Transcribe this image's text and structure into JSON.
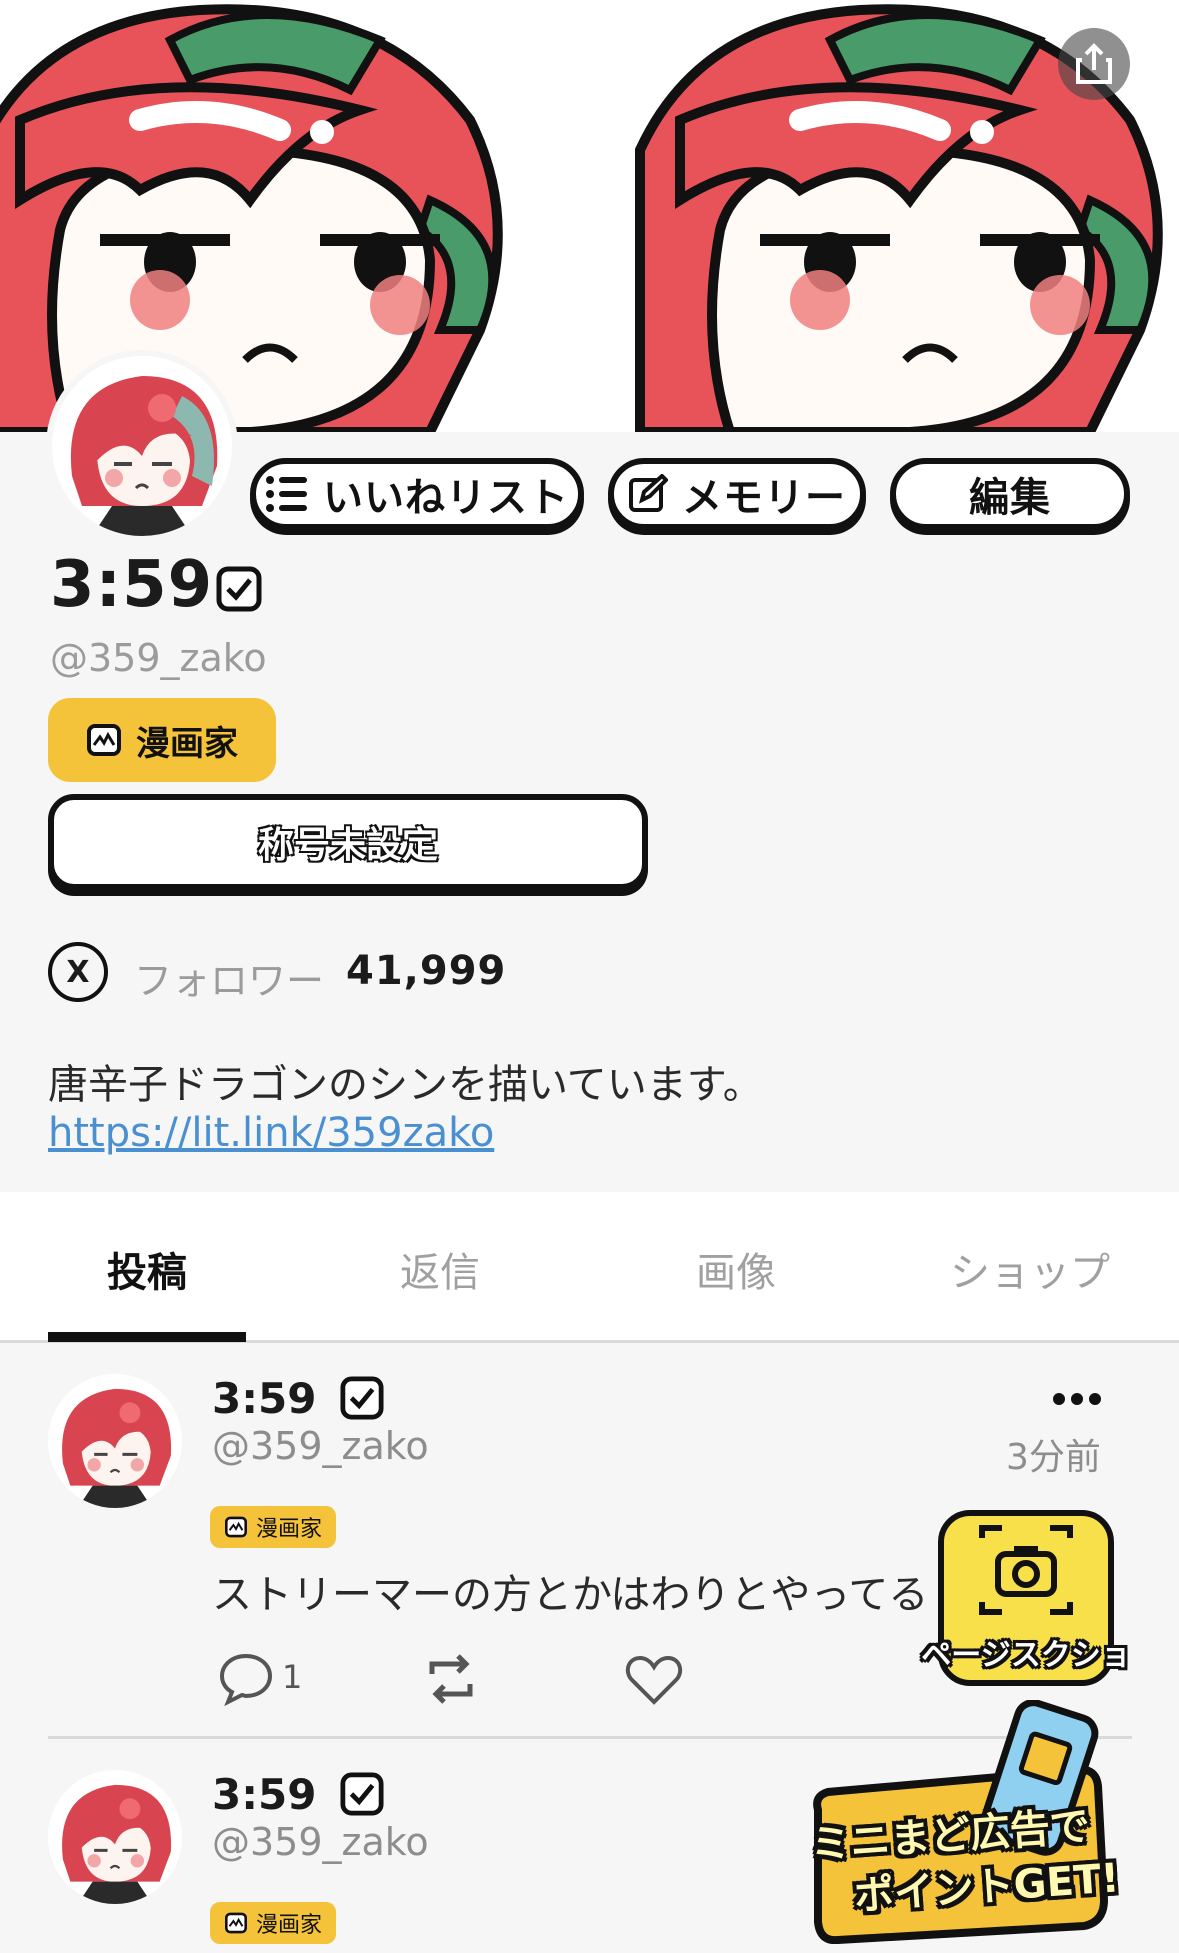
{
  "header": {
    "share_icon": "share-icon",
    "buttons": {
      "likes_list": "いいねリスト",
      "memory": "メモリー",
      "edit": "編集"
    }
  },
  "profile": {
    "name": "3:59",
    "handle": "@359_zako",
    "role_badge": "漫画家",
    "title": "称号未設定",
    "x_icon_glyph": "X",
    "followers_label": "フォロワー",
    "followers_count": "41,999",
    "bio": "唐辛子ドラゴンのシンを描いています。",
    "link": "https://lit.link/359zako"
  },
  "tabs": [
    {
      "label": "投稿",
      "active": true
    },
    {
      "label": "返信",
      "active": false
    },
    {
      "label": "画像",
      "active": false
    },
    {
      "label": "ショップ",
      "active": false
    }
  ],
  "posts": [
    {
      "name": "3:59",
      "handle": "@359_zako",
      "badge": "漫画家",
      "time": "3分前",
      "text": "ストリーマーの方とかはわりとやってる",
      "reply_count": "1"
    },
    {
      "name": "3:59",
      "handle": "@359_zako",
      "badge": "漫画家"
    }
  ],
  "floating": {
    "screenshot_label": "ページスクショ",
    "promo_line1": "ミニまど広告で",
    "promo_line2": "ポイントGET!"
  },
  "colors": {
    "accent_yellow": "#f4c33a",
    "link_blue": "#4a90d0",
    "hair_red": "#e8535a",
    "hair_green": "#4a9b6a"
  }
}
